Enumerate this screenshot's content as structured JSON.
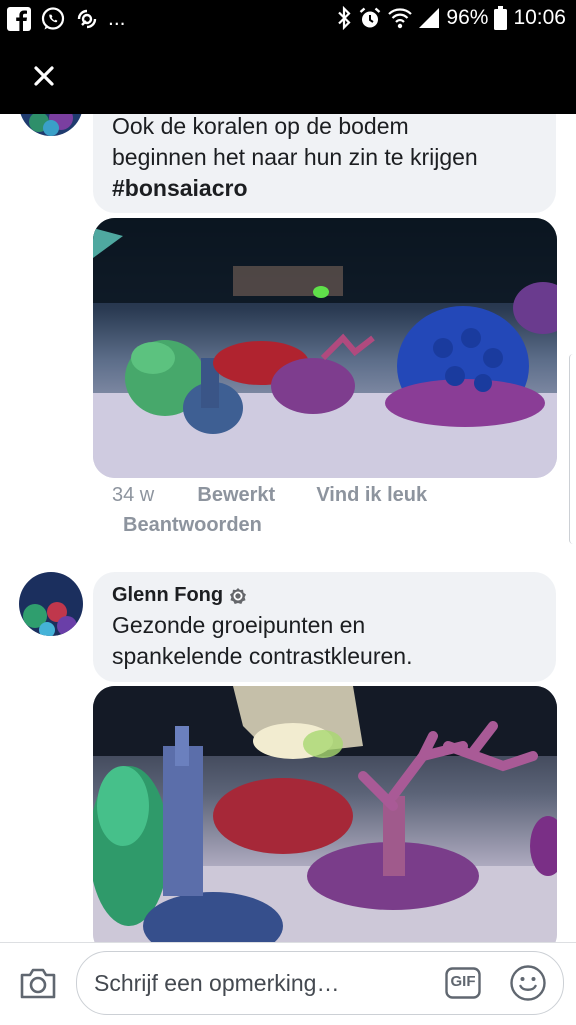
{
  "status_bar": {
    "battery": "96%",
    "time": "10:06",
    "overflow": "..."
  },
  "icons": {
    "facebook": "facebook-icon",
    "whatsapp": "whatsapp-icon",
    "notification": "notification-icon",
    "bluetooth": "bluetooth-icon",
    "alarm": "alarm-icon",
    "wifi": "wifi-icon",
    "signal": "signal-icon",
    "battery": "battery-icon",
    "close": "close-icon",
    "camera": "camera-icon",
    "gif": "gif-icon",
    "emoji": "emoji-icon",
    "verified": "verified-badge-icon"
  },
  "comments": [
    {
      "text_line1": "Ook de koralen op de bodem",
      "text_line2": "beginnen het naar hun zin te krijgen",
      "hashtag": "#bonsaiacro",
      "time": "34 w",
      "edited": "Bewerkt",
      "like": "Vind ik leuk",
      "reply": "Beantwoorden"
    },
    {
      "author": "Glenn Fong",
      "text_line1": "Gezonde groeipunten en",
      "text_line2": "spankelende contrastkleuren."
    }
  ],
  "composer": {
    "placeholder": "Schrijf een opmerking…",
    "gif_label": "GIF"
  },
  "colors": {
    "status_bar_bg": "#000000",
    "bubble_bg": "#f0f2f5",
    "meta_text": "#8d949e",
    "body_text": "#1c1e21"
  }
}
